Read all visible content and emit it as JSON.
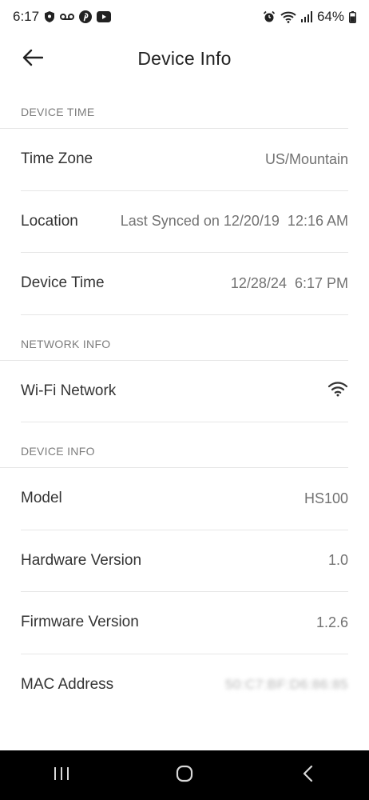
{
  "status_bar": {
    "time": "6:17",
    "battery": "64%",
    "icons_left": [
      "shield-icon",
      "voicemail-icon",
      "pinterest-icon",
      "youtube-icon"
    ],
    "icons_right": [
      "alarm-icon",
      "wifi-icon",
      "signal-icon",
      "battery-icon"
    ]
  },
  "header": {
    "title": "Device Info",
    "back_icon": "arrow-left-icon"
  },
  "sections": {
    "device_time": {
      "header": "DEVICE TIME",
      "rows": [
        {
          "label": "Time Zone",
          "value": "US/Mountain"
        },
        {
          "label": "Location",
          "value": "Last Synced on 12/20/19  12:16 AM"
        },
        {
          "label": "Device Time",
          "value": "12/28/24  6:17 PM"
        }
      ]
    },
    "network_info": {
      "header": "NETWORK INFO",
      "rows": [
        {
          "label": "Wi-Fi Network",
          "value_icon": "wifi-icon"
        }
      ]
    },
    "device_info": {
      "header": "DEVICE INFO",
      "rows": [
        {
          "label": "Model",
          "value": "HS100"
        },
        {
          "label": "Hardware Version",
          "value": "1.0"
        },
        {
          "label": "Firmware Version",
          "value": "1.2.6"
        },
        {
          "label": "MAC Address",
          "value": "50:C7:BF:D6:86:85",
          "obscured": true
        }
      ]
    }
  },
  "nav_bar": {
    "icons": [
      "recent-apps-icon",
      "home-icon",
      "back-icon"
    ]
  },
  "colors": {
    "background": "#ffffff",
    "divider": "#e6e6e6",
    "section_header": "#7c7c7c",
    "nav_bar": "#000000"
  }
}
